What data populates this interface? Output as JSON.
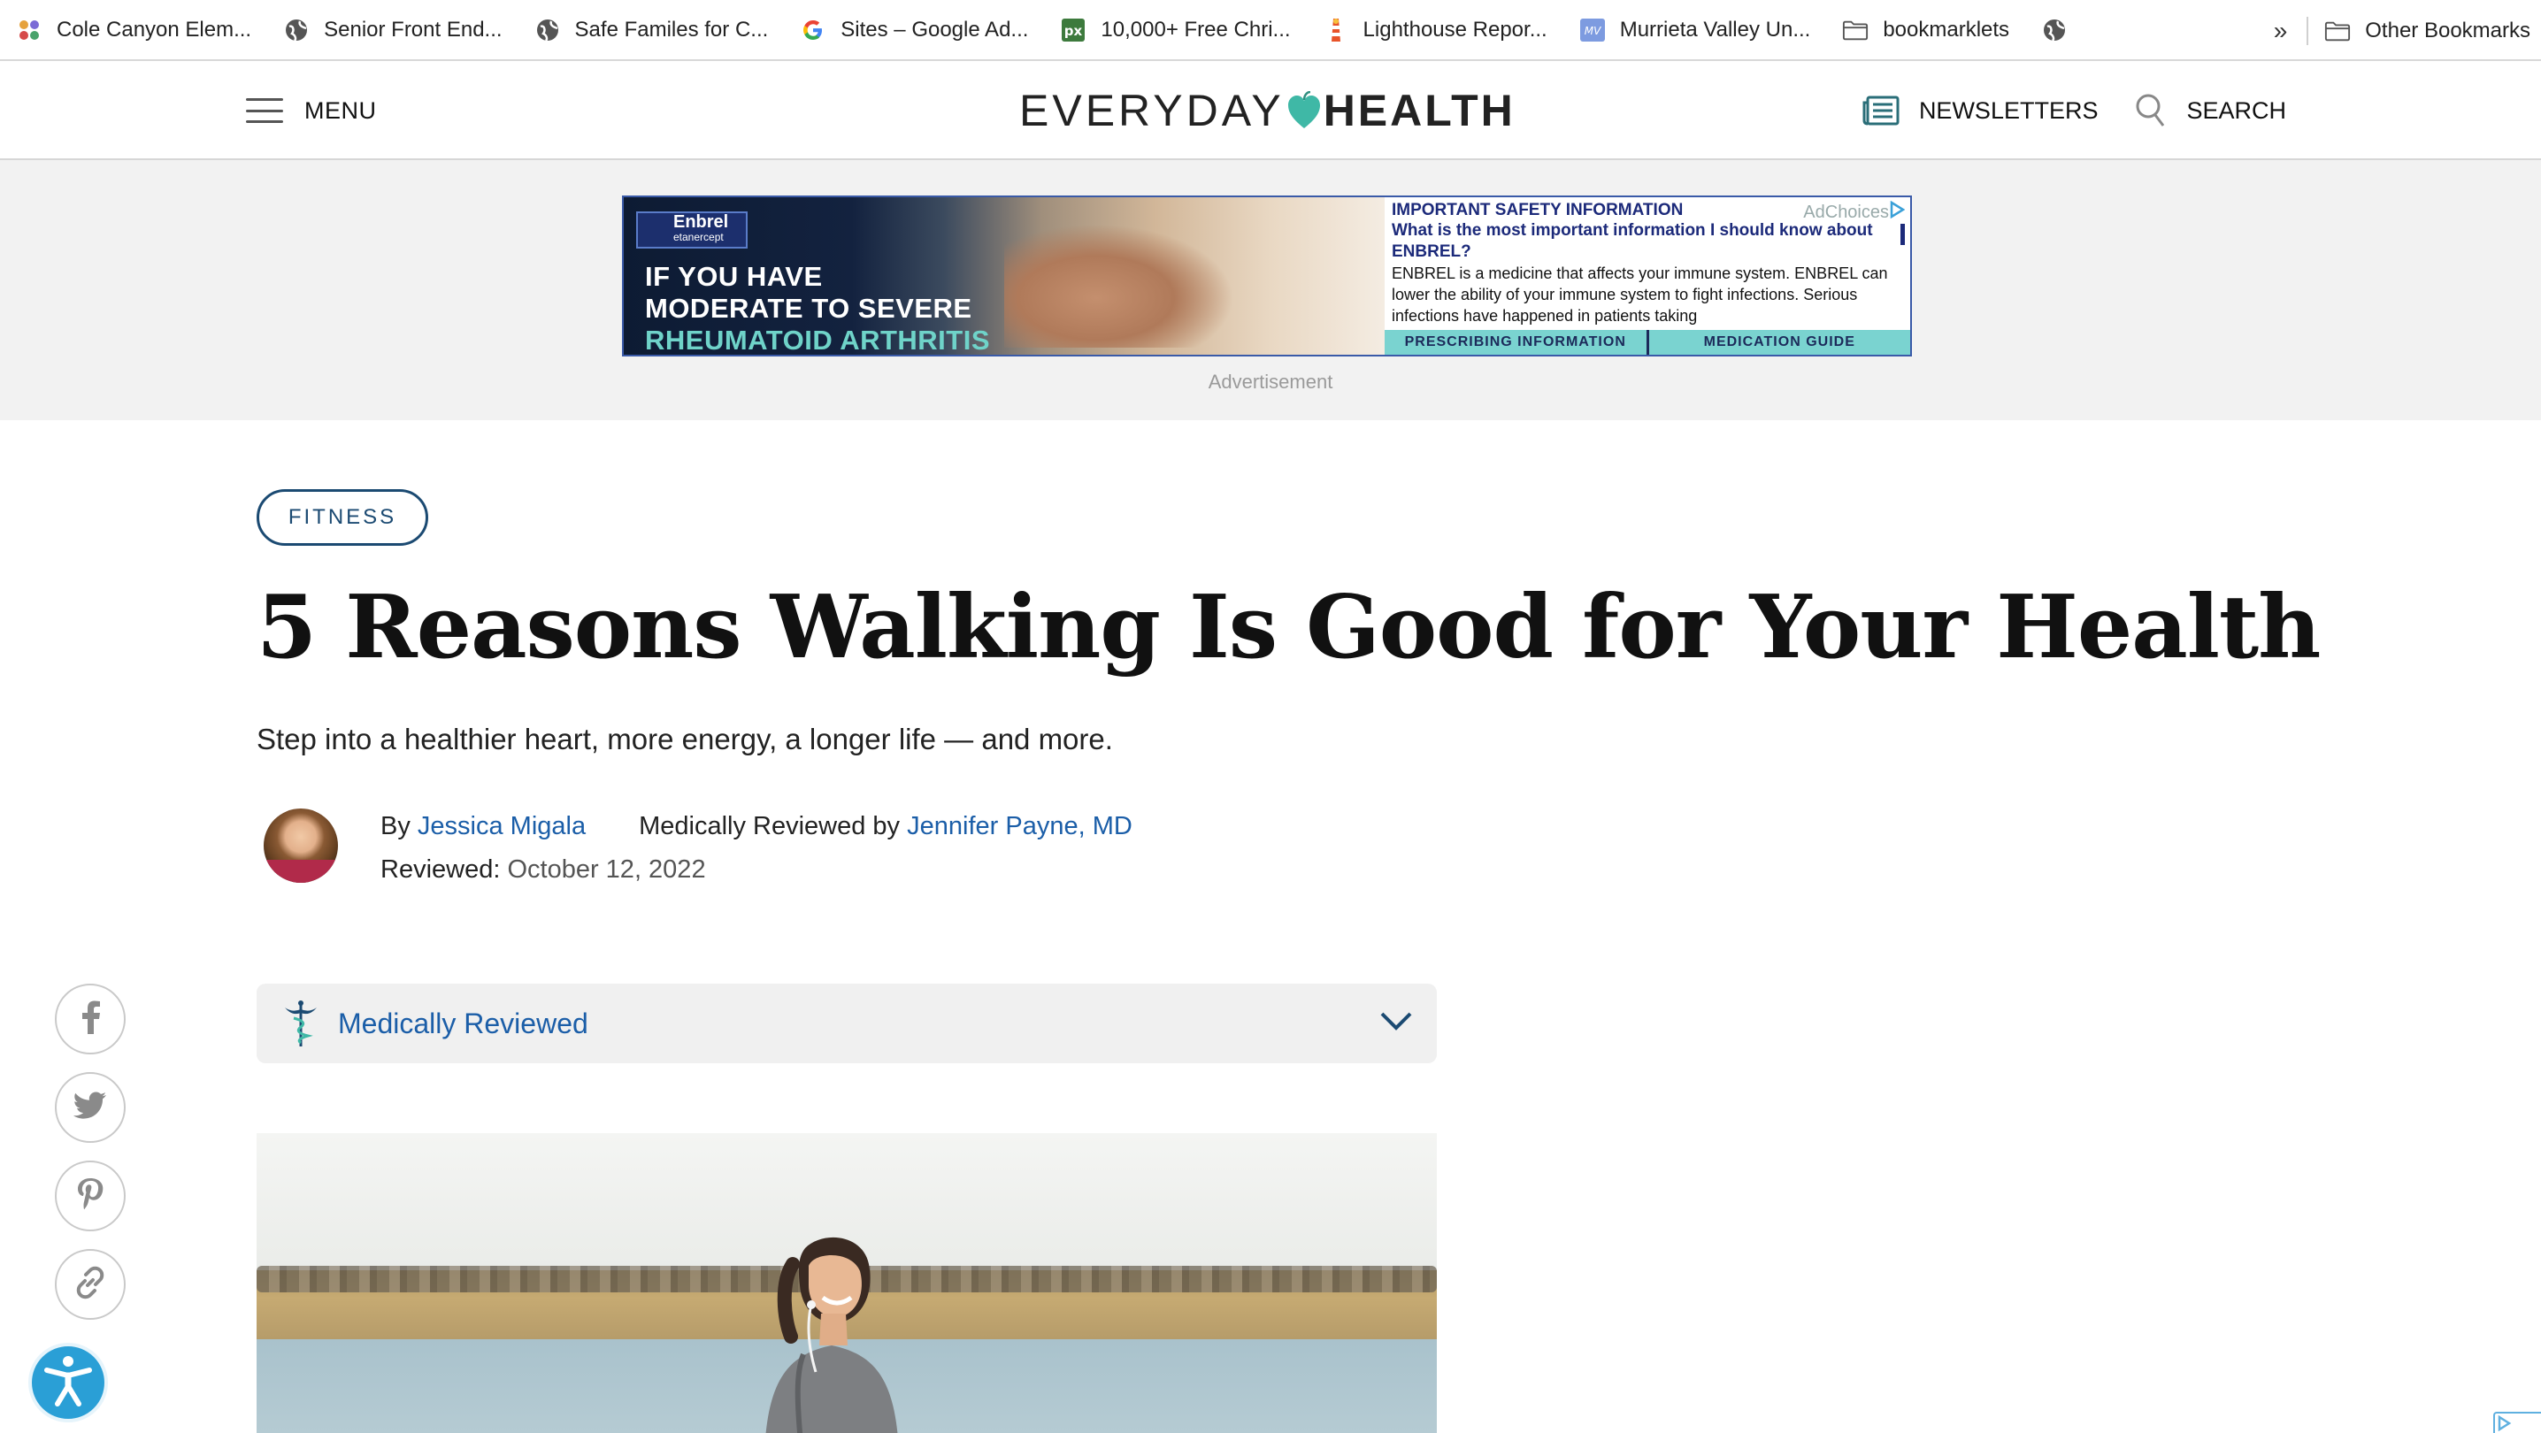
{
  "bookmarks": [
    {
      "label": "Cole Canyon Elem...",
      "icon": "school-favicon"
    },
    {
      "label": "Senior Front End...",
      "icon": "globe-icon"
    },
    {
      "label": "Safe Familes for C...",
      "icon": "globe-icon"
    },
    {
      "label": "Sites – Google Ad...",
      "icon": "google-icon"
    },
    {
      "label": "10,000+ Free Chri...",
      "icon": "px-favicon"
    },
    {
      "label": "Lighthouse Repor...",
      "icon": "lighthouse-icon"
    },
    {
      "label": "Murrieta Valley Un...",
      "icon": "district-favicon"
    },
    {
      "label": "bookmarklets",
      "icon": "folder-icon"
    }
  ],
  "bookmarks_overflow": "»",
  "other_bookmarks": "Other Bookmarks",
  "header": {
    "menu_label": "MENU",
    "logo_left": "EVERYDAY",
    "logo_right": "HEALTH",
    "newsletters_label": "NEWSLETTERS",
    "search_label": "SEARCH"
  },
  "ad": {
    "brand": "Enbrel",
    "brand_sub": "etanercept",
    "headline_line1": "IF YOU HAVE",
    "headline_line2": "MODERATE TO SEVERE",
    "headline_line3": "RHEUMATOID ARTHRITIS",
    "isi_title": "IMPORTANT SAFETY INFORMATION",
    "isi_question": "What is the most important information I should know about ENBREL?",
    "isi_body": "ENBREL is a medicine that affects your immune system. ENBREL can lower the ability of your immune system to fight infections. Serious infections have happened in patients taking",
    "adchoices": "AdChoices",
    "link_prescribing": "PRESCRIBING INFORMATION",
    "link_medguide": "MEDICATION GUIDE",
    "caption": "Advertisement"
  },
  "article": {
    "tag": "FITNESS",
    "title": "5 Reasons Walking Is Good for Your Health",
    "dek": "Step into a healthier heart, more energy, a longer life — and more.",
    "by_prefix": "By",
    "author": "Jessica Migala",
    "reviewed_by_prefix": "Medically Reviewed by",
    "reviewer": "Jennifer Payne, MD",
    "reviewed_label": "Reviewed:",
    "reviewed_date": "October 12, 2022",
    "accordion_label": "Medically Reviewed"
  },
  "share": [
    "facebook-icon",
    "twitter-icon",
    "pinterest-icon",
    "link-icon"
  ],
  "colors": {
    "brand_blue": "#1b4a72",
    "link_blue": "#1b5ea8",
    "logo_heart": "#3fb8a6",
    "accessibility": "#2a9fd6"
  }
}
